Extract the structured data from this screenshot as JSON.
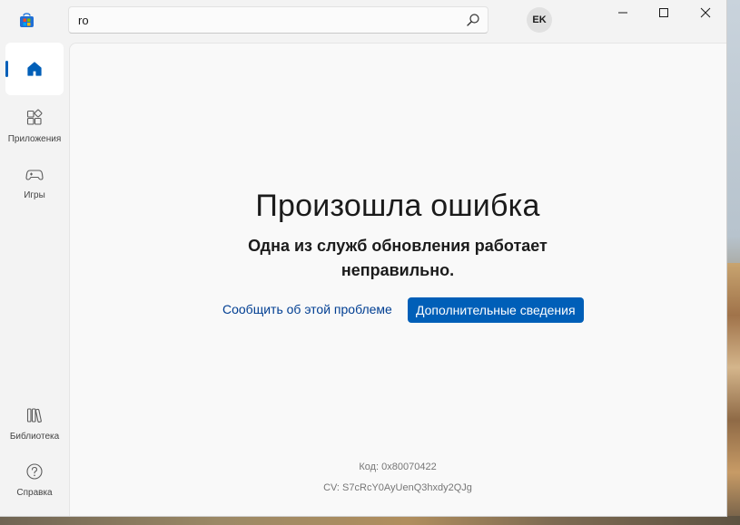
{
  "search": {
    "value": "ro",
    "placeholder": ""
  },
  "user": {
    "initials": "EK"
  },
  "nav": {
    "home": {
      "label": ""
    },
    "apps": {
      "label": "Приложения"
    },
    "games": {
      "label": "Игры"
    },
    "library": {
      "label": "Библиотека"
    },
    "help": {
      "label": "Справка"
    }
  },
  "error": {
    "title": "Произошла ошибка",
    "description": "Одна из служб обновления работает неправильно.",
    "report_link": "Сообщить об этой проблеме",
    "more_info_button": "Дополнительные сведения",
    "code": "Код: 0x80070422",
    "cv": "CV: S7cRcY0AyUenQ3hxdy2QJg"
  },
  "colors": {
    "accent": "#005fb8",
    "link": "#003e92",
    "window_bg": "#f3f3f3",
    "content_bg": "#f9f9f9"
  },
  "icons": {
    "app": "microsoft-store-icon",
    "search": "search-icon",
    "home": "home-icon",
    "apps": "apps-grid-icon",
    "games": "gamepad-icon",
    "library": "library-icon",
    "help": "help-icon",
    "minimize": "minimize-icon",
    "maximize": "maximize-icon",
    "close": "close-icon"
  }
}
